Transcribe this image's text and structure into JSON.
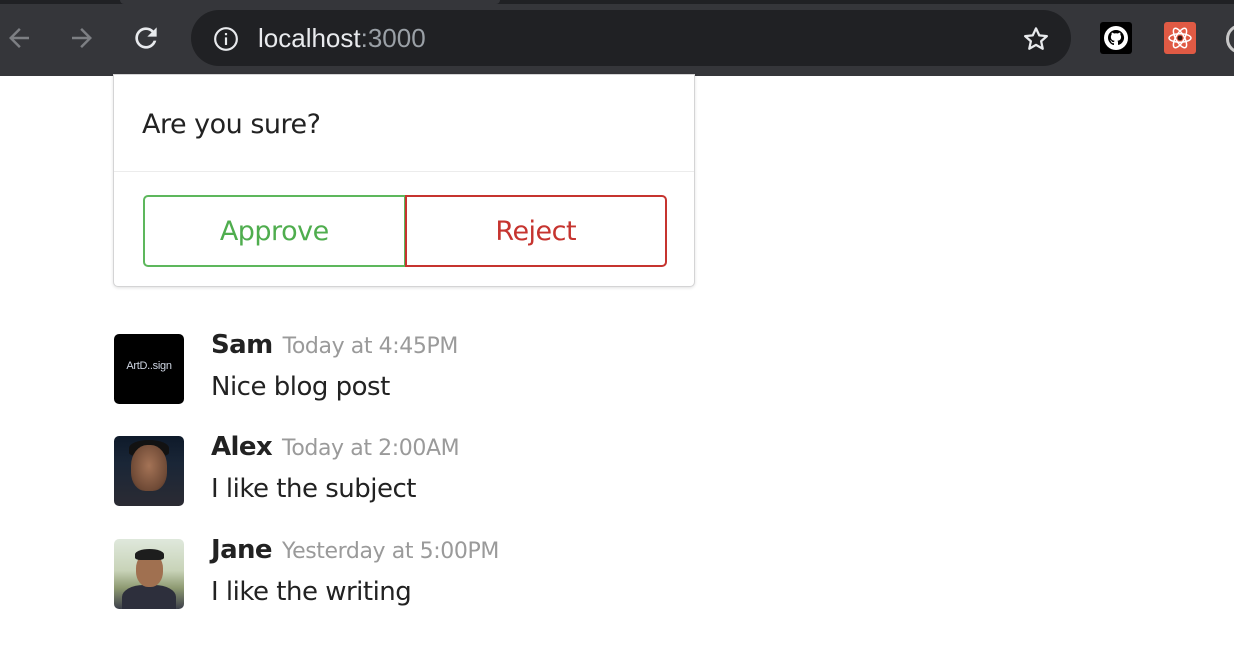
{
  "browser": {
    "url_host": "localhost",
    "url_port": ":3000",
    "icons": [
      "back-arrow-icon",
      "forward-arrow-icon",
      "reload-icon",
      "info-icon",
      "star-icon",
      "github-icon",
      "react-devtools-icon"
    ]
  },
  "confirm": {
    "question": "Are you sure?",
    "approve_label": "Approve",
    "reject_label": "Reject",
    "colors": {
      "approve": "#4fad4e",
      "reject": "#c6342f"
    }
  },
  "comments": [
    {
      "author": "Sam",
      "time": "Today at 4:45PM",
      "text": "Nice blog post",
      "avatar_text": "ArtD..sign"
    },
    {
      "author": "Alex",
      "time": "Today at 2:00AM",
      "text": "I like the subject"
    },
    {
      "author": "Jane",
      "time": "Yesterday at 5:00PM",
      "text": "I like the writing"
    }
  ]
}
